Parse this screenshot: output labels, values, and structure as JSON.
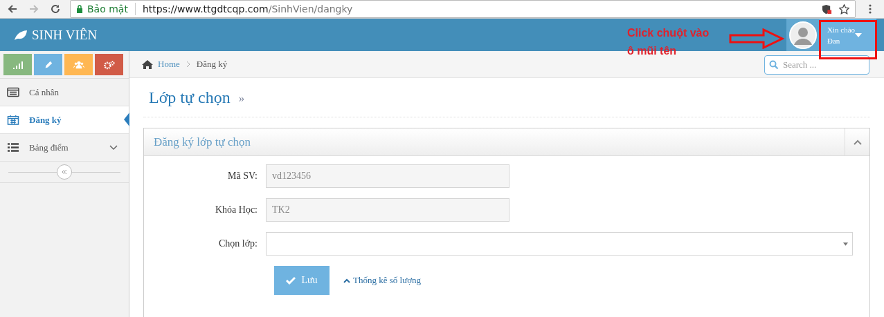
{
  "browser": {
    "security_label": "Bảo mật",
    "url_host": "https://www.ttgdtcqp.com",
    "url_path": "/SinhVien/dangky"
  },
  "header": {
    "brand": "SINH VIÊN",
    "user": {
      "greeting": "Xin chào",
      "name": "Đan"
    }
  },
  "annotation": {
    "lines": [
      "Click chuột vào",
      "ô mũi tên"
    ]
  },
  "shortcuts": [
    {
      "kind": "stats",
      "color": "#87b87f"
    },
    {
      "kind": "edit",
      "color": "#6fb3e0"
    },
    {
      "kind": "users",
      "color": "#ffb752"
    },
    {
      "kind": "settings",
      "color": "#d15b47"
    }
  ],
  "sidebar": {
    "items": [
      {
        "kind": "card",
        "label": "Cá nhân",
        "selected": false
      },
      {
        "kind": "calendar",
        "label": "Đăng ký",
        "selected": true
      },
      {
        "kind": "list",
        "label": "Bảng điểm",
        "selected": false,
        "expanded": false
      }
    ]
  },
  "breadcrumb": [
    "Home",
    "Đăng ký"
  ],
  "search": {
    "placeholder": "Search ..."
  },
  "page_title": "Lớp tự chọn",
  "page_title_mark": "»",
  "panel": {
    "title": "Đăng ký lớp tự chọn",
    "collapsed": false,
    "fields": [
      {
        "kind": "text",
        "label": "Mã SV:",
        "value": "vd123456",
        "disabled": true
      },
      {
        "kind": "text",
        "label": "Khóa Học:",
        "value": "TK2",
        "disabled": true
      },
      {
        "kind": "select",
        "label": "Chọn lớp:",
        "disabled": false
      }
    ],
    "save_button": "Lưu",
    "stats_link": "Thống kê số lượng"
  }
}
